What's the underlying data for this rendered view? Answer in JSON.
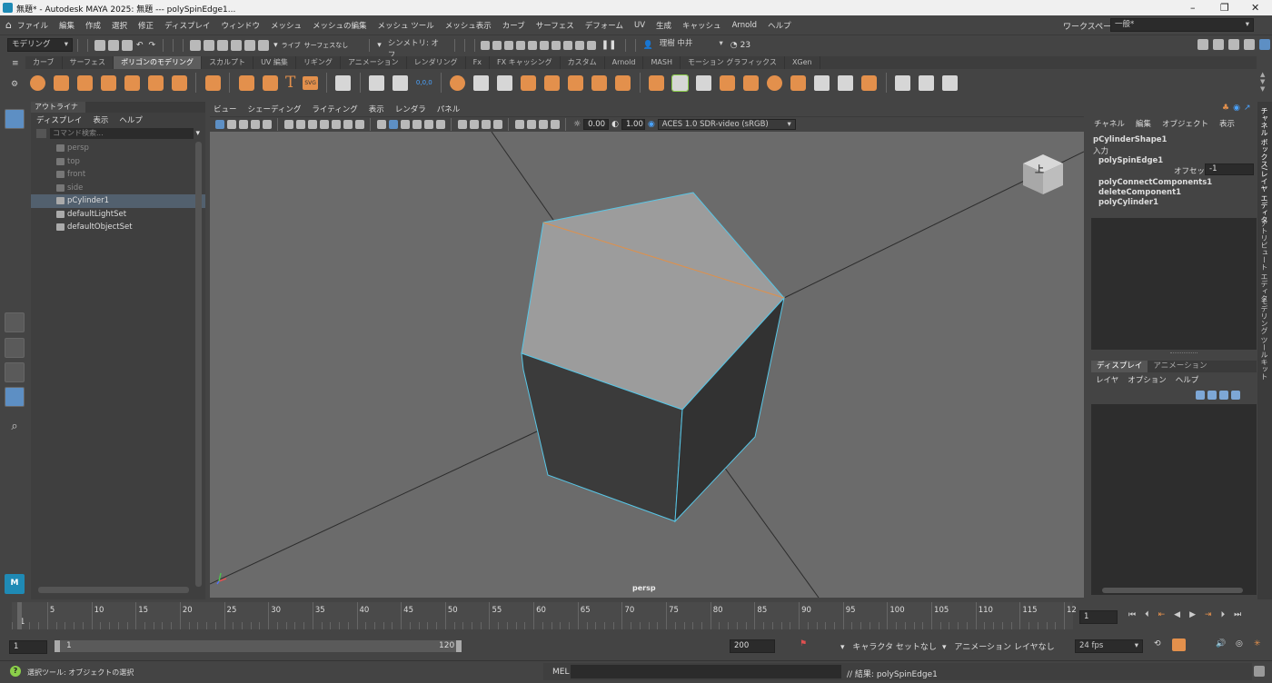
{
  "window": {
    "title": "無題* - Autodesk MAYA 2025: 無題  ---  polySpinEdge1...",
    "minimize": "–",
    "maximize": "❐",
    "close": "✕"
  },
  "menubar": {
    "items": [
      "ファイル",
      "編集",
      "作成",
      "選択",
      "修正",
      "ディスプレイ",
      "ウィンドウ",
      "メッシュ",
      "メッシュの編集",
      "メッシュ ツール",
      "メッシュ表示",
      "カーブ",
      "サーフェス",
      "デフォーム",
      "UV",
      "生成",
      "キャッシュ",
      "Arnold",
      "ヘルプ"
    ],
    "workspace_label": "ワークスペース:",
    "workspace_value": "一般*"
  },
  "statusline": {
    "mode": "モデリング",
    "live_label": "ライブ",
    "live_value": "サーフェスなし",
    "symmetry": "シンメトリ: オフ",
    "user": "理樹 中井",
    "counter": "23"
  },
  "shelf": {
    "tabs": [
      "カーブ",
      "サーフェス",
      "ポリゴンのモデリング",
      "スカルプト",
      "UV 編集",
      "リギング",
      "アニメーション",
      "レンダリング",
      "Fx",
      "FX キャッシング",
      "カスタム",
      "Arnold",
      "MASH",
      "モーション グラフィックス",
      "XGen"
    ],
    "active_tab": 2,
    "text_icon": "T",
    "svg_icon": "SVG",
    "coord_icon": "0,0,0"
  },
  "outliner": {
    "title": "アウトライナ",
    "menus": [
      "ディスプレイ",
      "表示",
      "ヘルプ"
    ],
    "search_placeholder": "コマンド検索...",
    "items": [
      {
        "label": "persp",
        "dim": true
      },
      {
        "label": "top",
        "dim": true
      },
      {
        "label": "front",
        "dim": true
      },
      {
        "label": "side",
        "dim": true
      },
      {
        "label": "pCylinder1",
        "dim": false,
        "selected": true
      },
      {
        "label": "defaultLightSet",
        "dim": false
      },
      {
        "label": "defaultObjectSet",
        "dim": false
      }
    ]
  },
  "viewport": {
    "menus": [
      "ビュー",
      "シェーディング",
      "ライティング",
      "表示",
      "レンダラ",
      "パネル"
    ],
    "exposure": "0.00",
    "gamma": "1.00",
    "colorspace": "ACES 1.0 SDR-video (sRGB)",
    "camera_label": "persp",
    "viewcube_face": "上"
  },
  "channelbox": {
    "menus": [
      "チャネル",
      "編集",
      "オブジェクト",
      "表示"
    ],
    "shape": "pCylinderShape1",
    "inputs_label": "入力",
    "node1": "polySpinEdge1",
    "offset_label": "オフセット",
    "offset_value": "-1",
    "node2": "polyConnectComponents1",
    "node3": "deleteComponent1",
    "node4": "polyCylinder1"
  },
  "layers": {
    "tabs": [
      "ディスプレイ",
      "アニメーション"
    ],
    "menus": [
      "レイヤ",
      "オプション",
      "ヘルプ"
    ]
  },
  "vtabs": {
    "channel": "チャネル ボックス/レイヤ エディタ",
    "attribute": "アトリビュート エディタ",
    "modeling": "モデリング ツールキット"
  },
  "timeslider": {
    "ticks": [
      "1",
      "5",
      "10",
      "15",
      "20",
      "25",
      "30",
      "35",
      "40",
      "45",
      "50",
      "55",
      "60",
      "65",
      "70",
      "75",
      "80",
      "85",
      "90",
      "95",
      "100",
      "105",
      "110",
      "115",
      "12"
    ],
    "current_frame": "1"
  },
  "range": {
    "start": "1",
    "inner_start": "1",
    "inner_end": "120",
    "end": "200",
    "character_set": "キャラクタ セットなし",
    "anim_layer": "アニメーション レイヤなし",
    "fps": "24 fps"
  },
  "helpline": {
    "help_text": "選択ツール: オブジェクトの選択",
    "mel_label": "MEL",
    "result": "// 結果: polySpinEdge1"
  }
}
